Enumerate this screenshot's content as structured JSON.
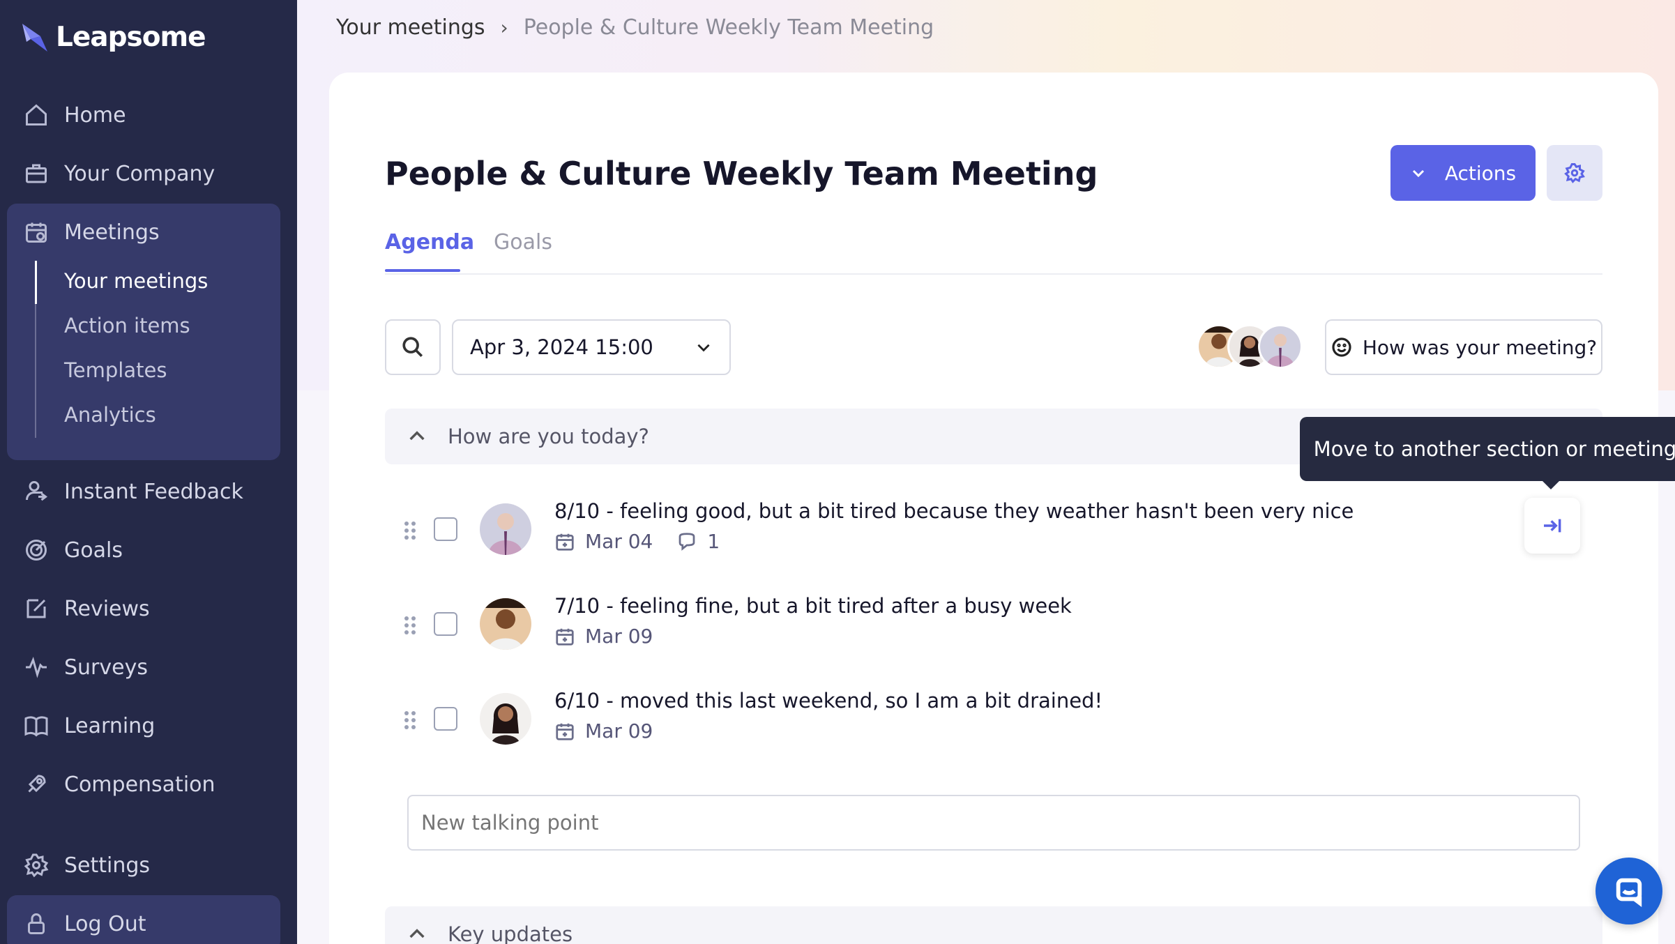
{
  "app": {
    "name": "Leapsome"
  },
  "sidebar": {
    "items": [
      {
        "label": "Home",
        "icon": "home-icon"
      },
      {
        "label": "Your Company",
        "icon": "briefcase-icon"
      },
      {
        "label": "Meetings",
        "icon": "calendar-icon"
      },
      {
        "label": "Instant Feedback",
        "icon": "feedback-icon"
      },
      {
        "label": "Goals",
        "icon": "target-icon"
      },
      {
        "label": "Reviews",
        "icon": "edit-icon"
      },
      {
        "label": "Surveys",
        "icon": "pulse-icon"
      },
      {
        "label": "Learning",
        "icon": "book-icon"
      },
      {
        "label": "Compensation",
        "icon": "rocket-icon"
      },
      {
        "label": "Settings",
        "icon": "gear-icon"
      },
      {
        "label": "Log Out",
        "icon": "lock-icon"
      }
    ],
    "meetings_sub": [
      "Your meetings",
      "Action items",
      "Templates",
      "Analytics"
    ],
    "active_sub": "Your meetings"
  },
  "breadcrumb": {
    "parent": "Your meetings",
    "separator": "›",
    "current": "People & Culture Weekly Team Meeting"
  },
  "page": {
    "title": "People & Culture Weekly Team Meeting",
    "actions_label": "Actions",
    "tabs": [
      "Agenda",
      "Goals"
    ],
    "active_tab": "Agenda",
    "date_value": "Apr 3, 2024 15:00",
    "feedback_label": "How was your meeting?"
  },
  "sections": [
    {
      "title": "How are you today?",
      "items": [
        {
          "text": "8/10 - feeling good, but a bit tired because they weather hasn't been very nice",
          "date": "Mar 04",
          "comments": "1"
        },
        {
          "text": "7/10 - feeling fine, but a bit tired after a busy week",
          "date": "Mar 09"
        },
        {
          "text": "6/10 - moved this last weekend, so I am a bit drained!",
          "date": "Mar 09"
        }
      ],
      "new_point_placeholder": "New talking point"
    },
    {
      "title": "Key updates"
    }
  ],
  "tooltip": {
    "text": "Move to another section or meeting"
  },
  "colors": {
    "sidebar_bg": "#252948",
    "accent": "#5a63e6",
    "tooltip_bg": "#262a40"
  }
}
